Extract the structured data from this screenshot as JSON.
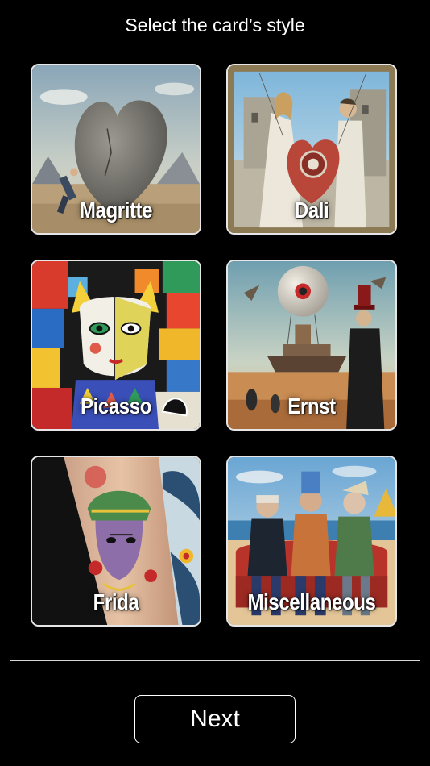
{
  "header": {
    "title": "Select the card’s style"
  },
  "styles": [
    {
      "label": "Magritte",
      "icon": "magritte-heart-boulder-artwork"
    },
    {
      "label": "Dali",
      "icon": "dali-surreal-heart-artwork"
    },
    {
      "label": "Picasso",
      "icon": "picasso-cubist-cat-woman-artwork"
    },
    {
      "label": "Ernst",
      "icon": "ernst-eye-balloon-ship-artwork"
    },
    {
      "label": "Frida",
      "icon": "frida-tattoo-arm-artwork"
    },
    {
      "label": "Miscellaneous",
      "icon": "misc-three-figures-sofa-artwork"
    }
  ],
  "footer": {
    "next_label": "Next"
  },
  "colors": {
    "background": "#000000",
    "text": "#ffffff",
    "card_border": "#e6e6e6"
  }
}
